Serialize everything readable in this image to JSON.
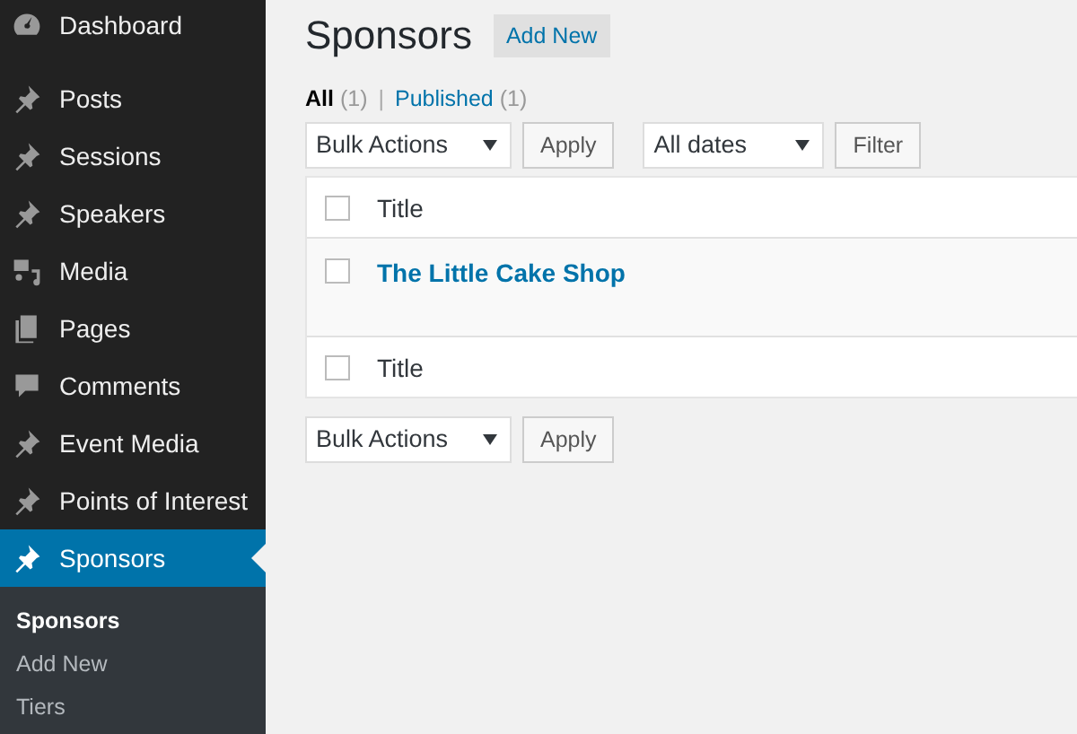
{
  "sidebar": {
    "items": [
      {
        "label": "Dashboard",
        "kind": "gauge",
        "selected": false
      },
      {
        "label": "Posts",
        "kind": "pin",
        "selected": false
      },
      {
        "label": "Sessions",
        "kind": "pin",
        "selected": false
      },
      {
        "label": "Speakers",
        "kind": "pin",
        "selected": false
      },
      {
        "label": "Media",
        "kind": "media",
        "selected": false
      },
      {
        "label": "Pages",
        "kind": "pages",
        "selected": false
      },
      {
        "label": "Comments",
        "kind": "comment",
        "selected": false
      },
      {
        "label": "Event Media",
        "kind": "pin",
        "selected": false
      },
      {
        "label": "Points of Interest",
        "kind": "pin",
        "selected": false
      },
      {
        "label": "Sponsors",
        "kind": "pin",
        "selected": true
      }
    ],
    "submenu": [
      {
        "label": "Sponsors",
        "selected": true
      },
      {
        "label": "Add New",
        "selected": false
      },
      {
        "label": "Tiers",
        "selected": false
      }
    ]
  },
  "page": {
    "title": "Sponsors",
    "add_button": "Add New"
  },
  "views": [
    {
      "label": "All",
      "count": "(1)",
      "selected": true
    },
    {
      "label": "Published",
      "count": "(1)",
      "selected": false
    }
  ],
  "views_separator": "|",
  "top_actions": {
    "bulk": "Bulk Actions",
    "apply": "Apply",
    "dates": "All dates",
    "filter": "Filter"
  },
  "table": {
    "header": "Title",
    "footer": "Title",
    "header_checked": false,
    "footer_checked": false,
    "rows": [
      {
        "title": "The Little Cake Shop",
        "checked": false
      }
    ]
  },
  "bottom_actions": {
    "bulk": "Bulk Actions",
    "apply": "Apply"
  }
}
